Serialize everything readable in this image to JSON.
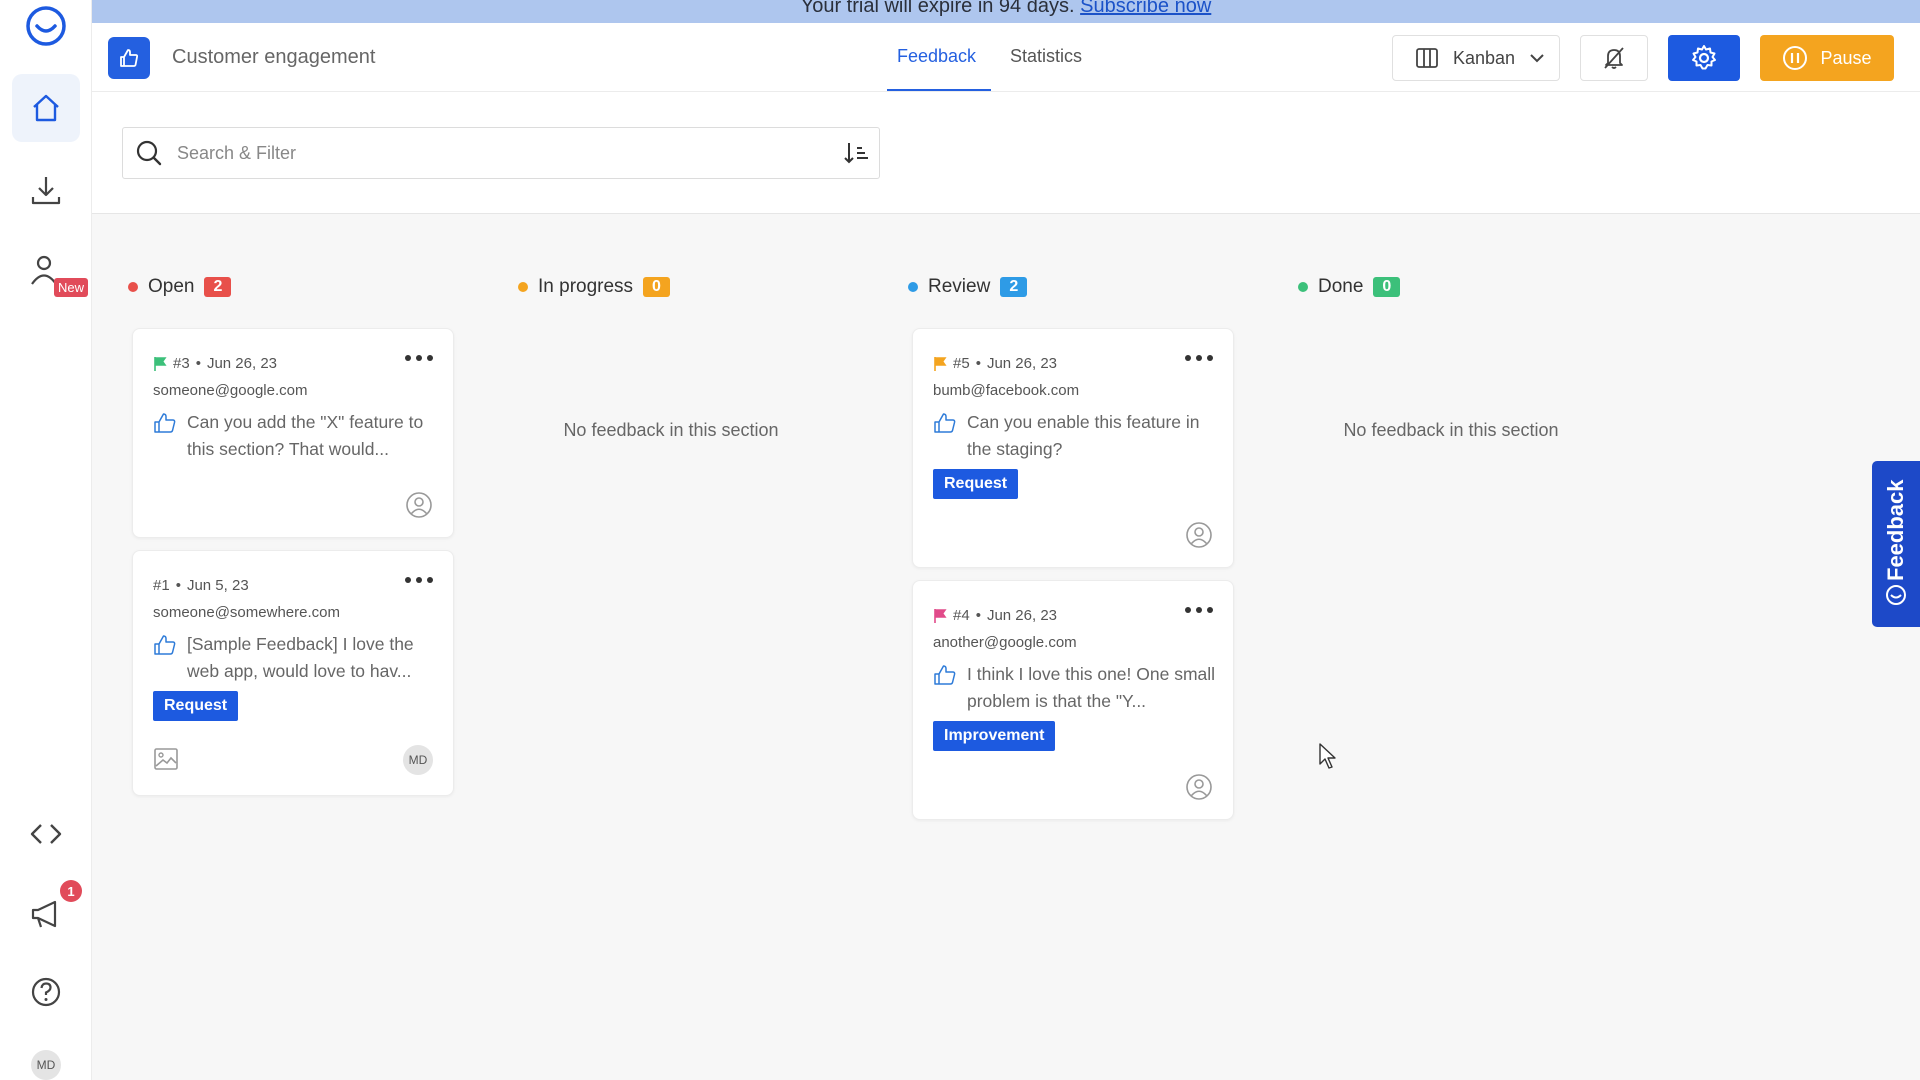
{
  "banner": {
    "text": "Your trial will expire in 94 days.",
    "link": "Subscribe now"
  },
  "sidebar": {
    "new_badge": "New",
    "notification_count": "1",
    "avatar": "MD"
  },
  "header": {
    "title": "Customer engagement",
    "tabs": [
      {
        "label": "Feedback",
        "active": true
      },
      {
        "label": "Statistics",
        "active": false
      }
    ],
    "view_label": "Kanban",
    "pause_label": "Pause"
  },
  "search": {
    "placeholder": "Search & Filter"
  },
  "columns": [
    {
      "name": "Open",
      "count": "2",
      "dot_color": "#e8504a",
      "count_color": "#e8504a"
    },
    {
      "name": "In progress",
      "count": "0",
      "dot_color": "#f4a41f",
      "count_color": "#f4a41f",
      "empty": "No feedback in this section"
    },
    {
      "name": "Review",
      "count": "2",
      "dot_color": "#2e9be6",
      "count_color": "#2e9be6"
    },
    {
      "name": "Done",
      "count": "0",
      "dot_color": "#3cc07a",
      "count_color": "#3cc07a",
      "empty": "No feedback in this section"
    }
  ],
  "cards": {
    "c3": {
      "id": "#3",
      "date": "Jun 26, 23",
      "email": "someone@google.com",
      "text": "Can you add the \"X\" feature to this section? That would...",
      "flag_color": "#3cc07a"
    },
    "c1": {
      "id": "#1",
      "date": "Jun 5, 23",
      "email": "someone@somewhere.com",
      "text": "[Sample Feedback] I love the web app, would love to hav...",
      "tag": "Request",
      "avatar": "MD"
    },
    "c5": {
      "id": "#5",
      "date": "Jun 26, 23",
      "email": "bumb@facebook.com",
      "text": "Can you enable this feature in the staging?",
      "tag": "Request",
      "flag_color": "#f4a41f"
    },
    "c4": {
      "id": "#4",
      "date": "Jun 26, 23",
      "email": "another@google.com",
      "text": "I think I love this one! One small problem is that the \"Y...",
      "tag": "Improvement",
      "flag_color": "#e14b8a"
    }
  },
  "feedback_tab": {
    "label": "Feedback"
  },
  "colors": {
    "primary": "#1d5ae0",
    "pause": "#f4a41f",
    "banner": "#aec6ee"
  }
}
